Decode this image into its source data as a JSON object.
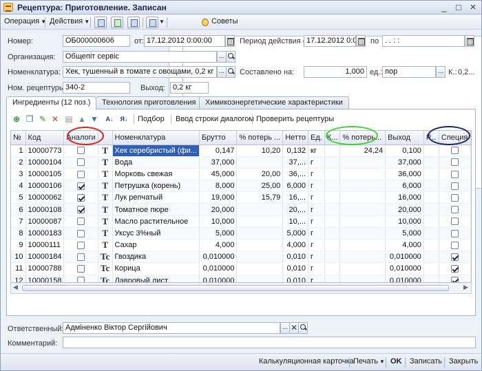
{
  "window": {
    "title": "Рецептура: Приготовление. Записан",
    "controls": {
      "minimize": "_",
      "maximize": "□",
      "close": "×"
    }
  },
  "toolbar": {
    "operation": "Операция",
    "actions": "Действия",
    "tips": "Советы"
  },
  "header": {
    "number_label": "Номер:",
    "number_value": "ОБ000000606",
    "from_label": "от:",
    "from_value": "17.12.2012  0:00:00",
    "period_label": "Период действия с:",
    "period_from": "17.12.2012 0:00",
    "period_to_label": "по",
    "period_to": " .  .     :  :",
    "org_label": "Организация:",
    "org_value": "Общепіт сервіс",
    "nom_label": "Номенклатура:",
    "nom_value": "Хек, тушенный в томате с овощами, 0,2 кг",
    "composed_label": "Составлено на:",
    "composed_value": "1,000",
    "unit_label": "ед.:",
    "unit_value": "пор",
    "k_label": "К.:",
    "k_value": "0,2...",
    "recipe_label": "Ном. рецептуры:",
    "recipe_value": "340-2",
    "output_label": "Выход:",
    "output_value": "0,2 кг",
    "ellipsis": "..."
  },
  "tabs": [
    {
      "label": "Ингредиенты (12 поз.)"
    },
    {
      "label": "Технология приготовления"
    },
    {
      "label": "Химикоэнергетические характеристики"
    }
  ],
  "inner_toolbar": {
    "pick": "Подбор",
    "dialog_input": "Ввод строки диалогом",
    "check": "Проверить рецептуры",
    "sort_az": "А↓",
    "sort_za": "Я↓"
  },
  "table": {
    "columns": [
      "№",
      "Код",
      "Аналоги",
      "",
      "Номенклатура",
      "Брутто",
      "% потерь ...",
      "Нетто",
      "Ед.",
      "К...",
      "% потерь...",
      "Выход",
      "Р...",
      "Специя"
    ],
    "rows": [
      {
        "n": "1",
        "code": "10000773",
        "analog": false,
        "t": "T",
        "name": "Хек серебристый (фи...",
        "brutto": "0,147",
        "loss": "10,20",
        "netto": "0,132",
        "unit": "кг",
        "k": "",
        "loss2": "24,24",
        "out": "0,100",
        "r": "",
        "spice": false
      },
      {
        "n": "2",
        "code": "10000104",
        "analog": false,
        "t": "T",
        "name": "Вода",
        "brutto": "37,000",
        "loss": "",
        "netto": "37,...",
        "unit": "г",
        "k": "",
        "loss2": "",
        "out": "37,000",
        "r": "",
        "spice": false
      },
      {
        "n": "3",
        "code": "10000105",
        "analog": false,
        "t": "T",
        "name": "Морковь свежая",
        "brutto": "45,000",
        "loss": "20,00",
        "netto": "36,...",
        "unit": "г",
        "k": "",
        "loss2": "",
        "out": "36,000",
        "r": "",
        "spice": false
      },
      {
        "n": "4",
        "code": "10000106",
        "analog": true,
        "t": "T",
        "name": "Петрушка (корень)",
        "brutto": "8,000",
        "loss": "25,00",
        "netto": "6,000",
        "unit": "г",
        "k": "",
        "loss2": "",
        "out": "6,000",
        "r": "",
        "spice": false
      },
      {
        "n": "5",
        "code": "10000062",
        "analog": true,
        "t": "T",
        "name": "Лук репчатый",
        "brutto": "19,000",
        "loss": "15,79",
        "netto": "16,...",
        "unit": "г",
        "k": "",
        "loss2": "",
        "out": "16,000",
        "r": "",
        "spice": false
      },
      {
        "n": "6",
        "code": "10000108",
        "analog": true,
        "t": "T",
        "name": "Томатное пюре",
        "brutto": "20,000",
        "loss": "",
        "netto": "20,...",
        "unit": "г",
        "k": "",
        "loss2": "",
        "out": "20,000",
        "r": "",
        "spice": false
      },
      {
        "n": "7",
        "code": "10000087",
        "analog": false,
        "t": "T",
        "name": "Масло растительное",
        "brutto": "10,000",
        "loss": "",
        "netto": "10,...",
        "unit": "г",
        "k": "",
        "loss2": "",
        "out": "10,000",
        "r": "",
        "spice": false
      },
      {
        "n": "8",
        "code": "10000183",
        "analog": false,
        "t": "T",
        "name": "Уксус 3%ный",
        "brutto": "5,000",
        "loss": "",
        "netto": "5,000",
        "unit": "г",
        "k": "",
        "loss2": "",
        "out": "5,000",
        "r": "",
        "spice": false
      },
      {
        "n": "9",
        "code": "10000111",
        "analog": false,
        "t": "T",
        "name": "Сахар",
        "brutto": "4,000",
        "loss": "",
        "netto": "4,000",
        "unit": "г",
        "k": "",
        "loss2": "",
        "out": "4,000",
        "r": "",
        "spice": false
      },
      {
        "n": "10",
        "code": "10000184",
        "analog": false,
        "t": "Tc",
        "name": "Гвоздика",
        "brutto": "0,010000",
        "loss": "",
        "netto": "0,010",
        "unit": "г",
        "k": "",
        "loss2": "",
        "out": "0,010000",
        "r": "",
        "spice": true
      },
      {
        "n": "11",
        "code": "10000788",
        "analog": false,
        "t": "Tc",
        "name": "Корица",
        "brutto": "0,010000",
        "loss": "",
        "netto": "0,010",
        "unit": "г",
        "k": "",
        "loss2": "",
        "out": "0,010000",
        "r": "",
        "spice": true
      },
      {
        "n": "12",
        "code": "10000158",
        "analog": false,
        "t": "Tc",
        "name": "Лавровый лист",
        "brutto": "0,010000",
        "loss": "",
        "netto": "0,010",
        "unit": "г",
        "k": "",
        "loss2": "",
        "out": "0,010000",
        "r": "",
        "spice": true
      }
    ]
  },
  "footer": {
    "responsible_label": "Ответственный:",
    "responsible_value": "Адміненко Віктор Сергійович",
    "comment_label": "Комментарий:",
    "comment_value": ""
  },
  "bottombar": {
    "calc_card": "Калькуляционная карточка",
    "print": "Печать",
    "ok": "OK",
    "save": "Записать",
    "close": "Закрыть"
  },
  "annotation_colors": {
    "analogs": "#e0201c",
    "loss_output": "#3fd22c",
    "spice": "#1a1f6e"
  }
}
